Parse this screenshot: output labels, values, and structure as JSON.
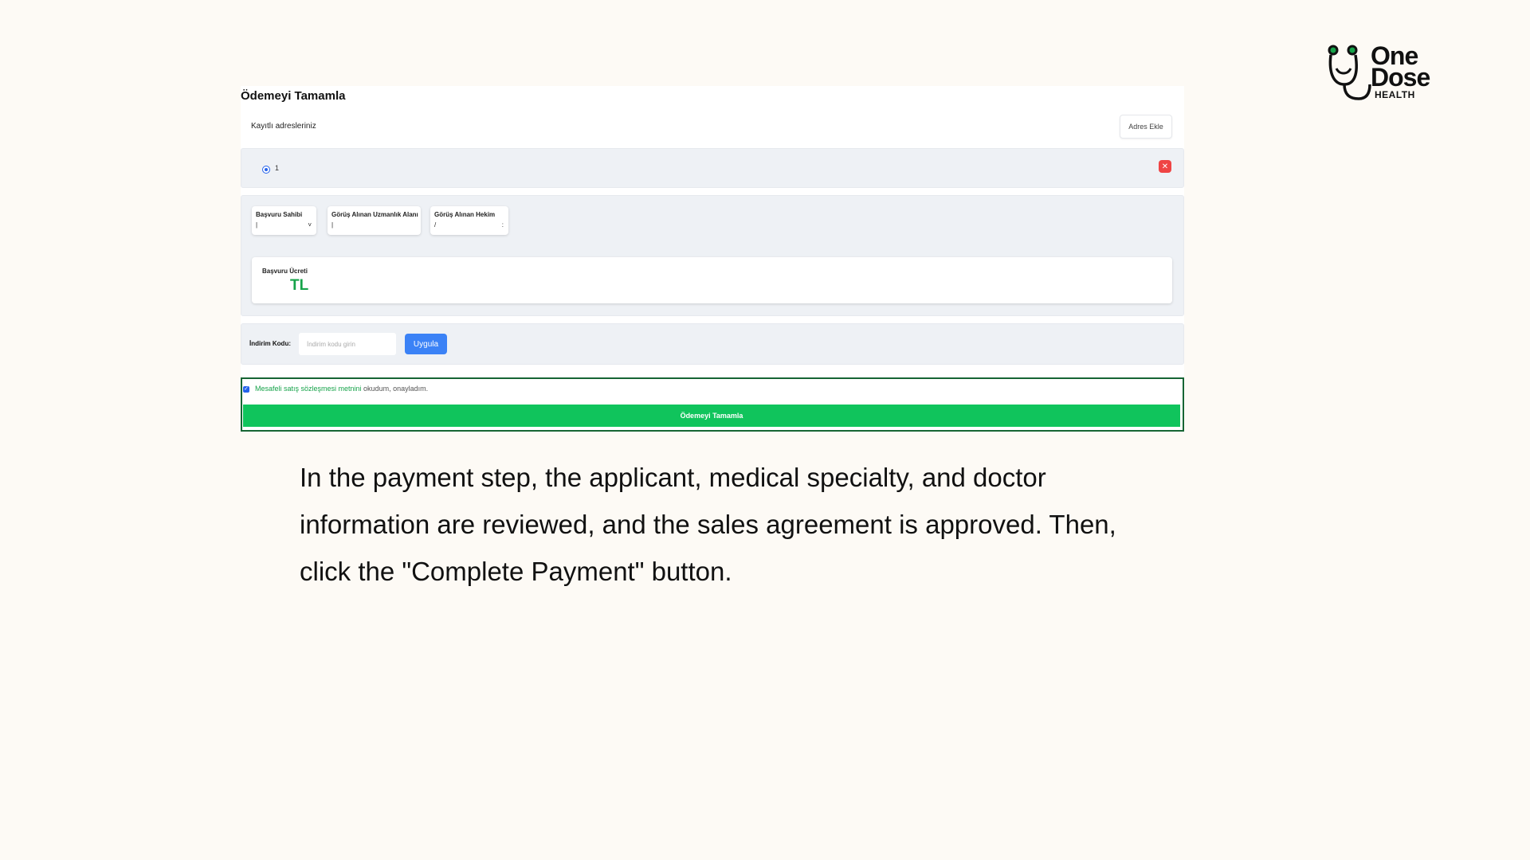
{
  "brand": {
    "name_line1": "One",
    "name_line2": "Dose",
    "name_line3": "HEALTH",
    "icon": "stethoscope-smile-icon",
    "accent_color": "#16a34a"
  },
  "panel": {
    "title": "Ödemeyi Tamamla",
    "addresses": {
      "label": "Kayıtlı adresleriniz",
      "add_button": "Adres Ekle",
      "items": [
        {
          "name": "1",
          "selected": true,
          "delete_icon": "close-icon"
        }
      ]
    },
    "info_cards": [
      {
        "label": "Başvuru Sahibi",
        "value": "|",
        "chevron": "˅"
      },
      {
        "label": "Görüş Alınan Uzmanlık Alanı",
        "value": "|",
        "chevron": ""
      },
      {
        "label": "Görüş Alınan Hekim",
        "value": "/",
        "chevron": ":"
      }
    ],
    "fee": {
      "label": "Başvuru Ücreti",
      "amount": "TL"
    },
    "discount": {
      "label": "İndirim Kodu:",
      "placeholder": "İndirim kodu girin",
      "value": "",
      "apply_button": "Uygula"
    },
    "agreement": {
      "checked": true,
      "link_text": "Mesafeli satış sözleşmesi metnini",
      "rest_text": " okudum, onayladım."
    },
    "complete_button": "Ödemeyi Tamamla"
  },
  "caption": "In the payment step, the applicant, medical specialty, and doctor information are reviewed, and the sales agreement is approved. Then, click the \"Complete Payment\" button."
}
